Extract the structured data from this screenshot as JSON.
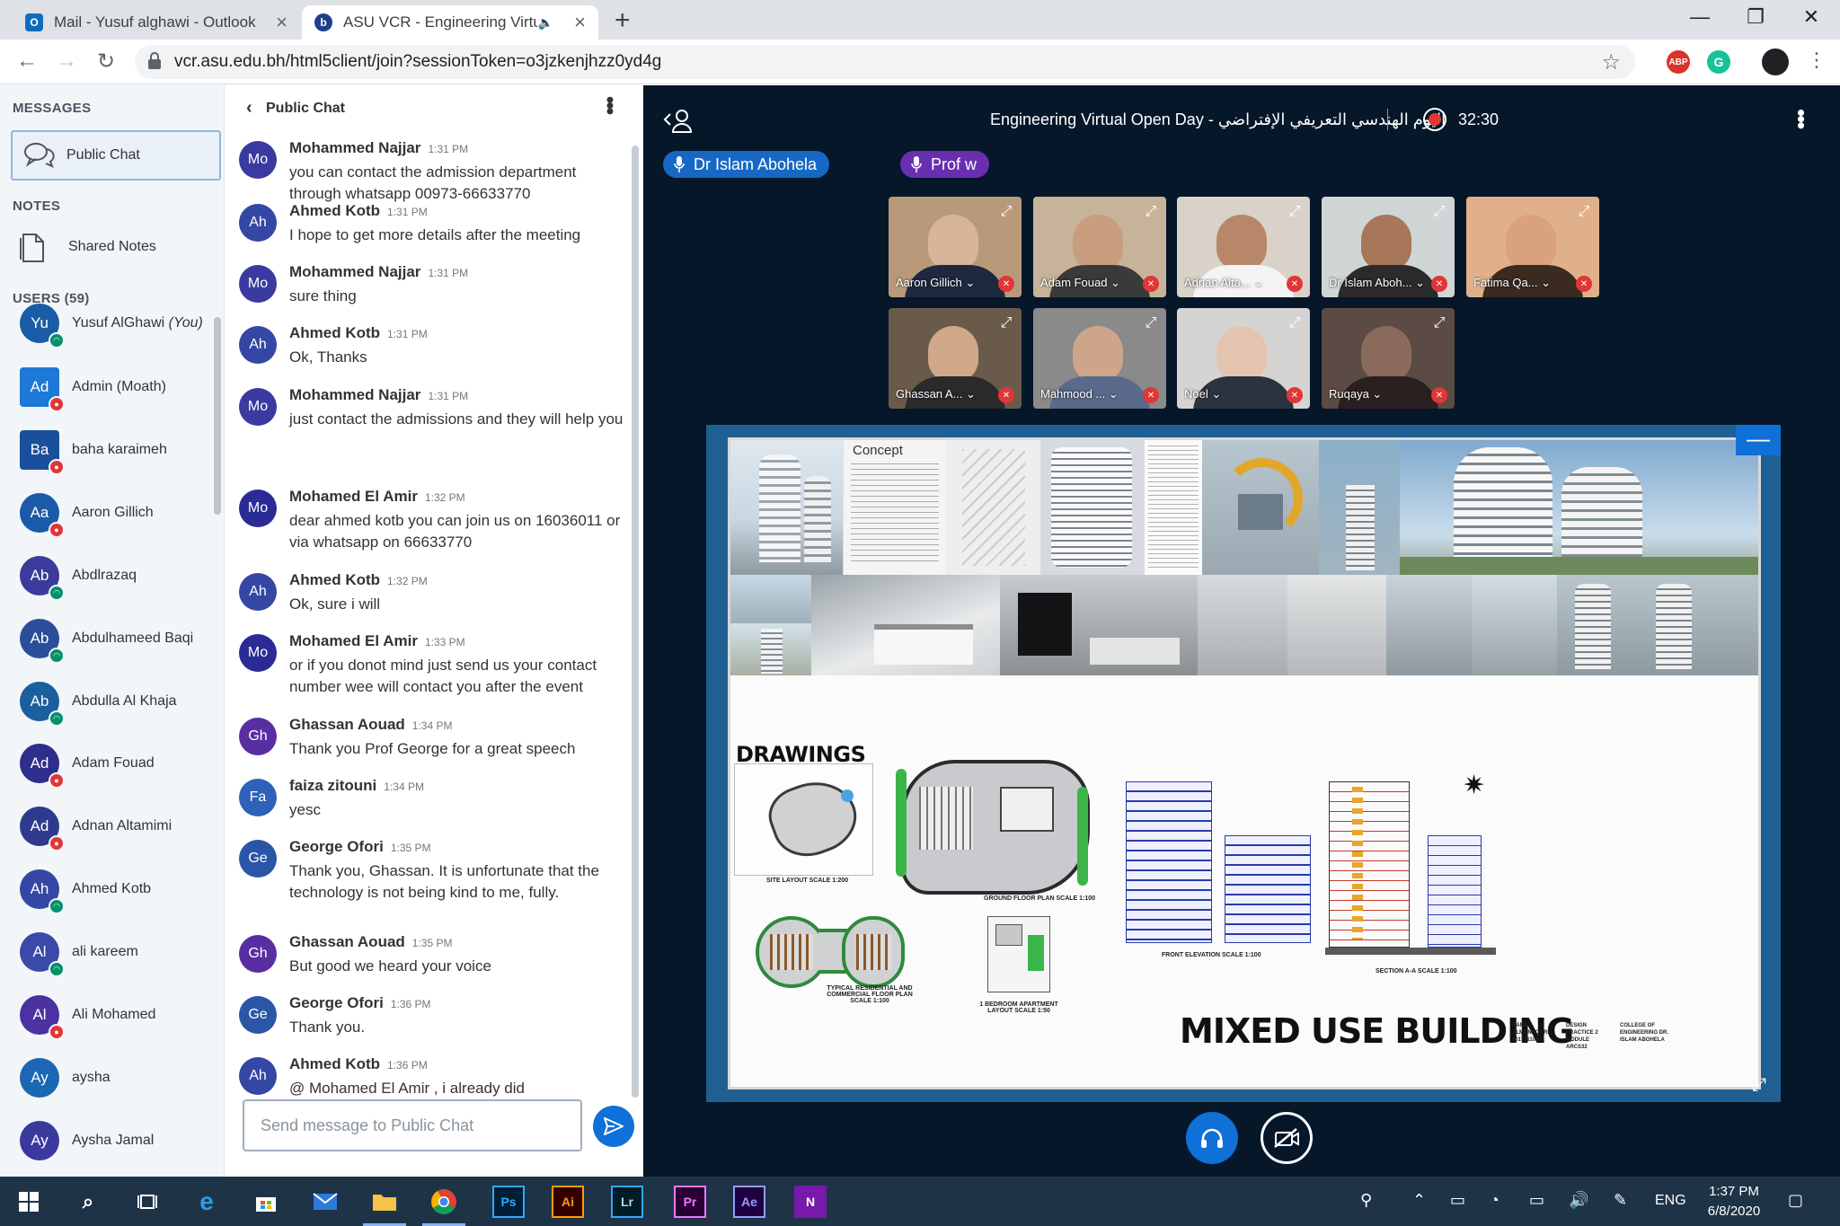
{
  "browser": {
    "tabs": [
      {
        "title": "Mail - Yusuf alghawi - Outlook",
        "icon": "outlook-icon",
        "active": false
      },
      {
        "title": "ASU VCR - Engineering Virtu",
        "icon": "bigbluebutton-icon",
        "active": true
      }
    ],
    "url": "vcr.asu.edu.bh/html5client/join?sessionToken=o3jzkenjhzz0yd4g",
    "extensions": [
      "ABP",
      "G"
    ]
  },
  "sidebar": {
    "messages_title": "MESSAGES",
    "public_chat_label": "Public Chat",
    "notes_title": "NOTES",
    "shared_notes_label": "Shared Notes",
    "users_title": "USERS (59)",
    "users": [
      {
        "initials": "Yu",
        "name": "Yusuf AlGhawi",
        "suffix": "(You)",
        "color": "#1a5ca6",
        "status": "listen"
      },
      {
        "initials": "Ad",
        "name": "Admin (Moath)",
        "suffix": "",
        "color": "#1d78d6",
        "status": "muted",
        "square": true
      },
      {
        "initials": "Ba",
        "name": "baha karaimeh",
        "suffix": "",
        "color": "#1a4f9c",
        "status": "muted",
        "square": true
      },
      {
        "initials": "Aa",
        "name": "Aaron Gillich",
        "suffix": "",
        "color": "#1b5aa8",
        "status": "muted"
      },
      {
        "initials": "Ab",
        "name": "Abdlrazaq",
        "suffix": "",
        "color": "#3b3b9c",
        "status": "listen"
      },
      {
        "initials": "Ab",
        "name": "Abdulhameed Baqi",
        "suffix": "",
        "color": "#2a4e9c",
        "status": "listen"
      },
      {
        "initials": "Ab",
        "name": "Abdulla Al Khaja",
        "suffix": "",
        "color": "#1a5f9e",
        "status": "listen"
      },
      {
        "initials": "Ad",
        "name": "Adam Fouad",
        "suffix": "",
        "color": "#2e2e8c",
        "status": "muted"
      },
      {
        "initials": "Ad",
        "name": "Adnan Altamimi",
        "suffix": "",
        "color": "#2f3a8f",
        "status": "muted"
      },
      {
        "initials": "Ah",
        "name": "Ahmed Kotb",
        "suffix": "",
        "color": "#3547a5",
        "status": "listen"
      },
      {
        "initials": "Al",
        "name": "ali kareem",
        "suffix": "",
        "color": "#3b4aa8",
        "status": "listen"
      },
      {
        "initials": "Al",
        "name": "Ali Mohamed",
        "suffix": "",
        "color": "#4a33a0",
        "status": "muted"
      },
      {
        "initials": "Ay",
        "name": "aysha",
        "suffix": "",
        "color": "#1b67b3",
        "status": ""
      },
      {
        "initials": "Ay",
        "name": "Aysha Jamal",
        "suffix": "",
        "color": "#3a3a9e",
        "status": ""
      }
    ]
  },
  "chat": {
    "title": "Public Chat",
    "input_placeholder": "Send message to Public Chat",
    "messages": [
      {
        "initials": "Mo",
        "sender": "Mohammed Najjar",
        "time": "1:31 PM",
        "text": "you can contact the admission department through whatsapp 00973-66633770",
        "color": "#3a3aa0"
      },
      {
        "initials": "Ah",
        "sender": "Ahmed Kotb",
        "time": "1:31 PM",
        "text": "I hope to get more details after the meeting",
        "color": "#3547a5"
      },
      {
        "initials": "Mo",
        "sender": "Mohammed Najjar",
        "time": "1:31 PM",
        "text": "sure thing",
        "color": "#3a3aa0"
      },
      {
        "initials": "Ah",
        "sender": "Ahmed Kotb",
        "time": "1:31 PM",
        "text": "Ok, Thanks",
        "color": "#3547a5"
      },
      {
        "initials": "Mo",
        "sender": "Mohammed Najjar",
        "time": "1:31 PM",
        "text": "just contact the admissions and they will help you",
        "color": "#3a3aa0"
      },
      {
        "initials": "Mo",
        "sender": "Mohamed El Amir",
        "time": "1:32 PM",
        "text": "dear ahmed kotb you can join us on 16036011 or via whatsapp on 66633770",
        "color": "#2b2b96"
      },
      {
        "initials": "Ah",
        "sender": "Ahmed Kotb",
        "time": "1:32 PM",
        "text": "Ok, sure i will",
        "color": "#3547a5"
      },
      {
        "initials": "Mo",
        "sender": "Mohamed El Amir",
        "time": "1:33 PM",
        "text": "or if you donot mind just send us your contact number wee will contact you after the event",
        "color": "#2b2b96"
      },
      {
        "initials": "Gh",
        "sender": "Ghassan Aouad",
        "time": "1:34 PM",
        "text": "Thank you Prof George for a great speech",
        "color": "#5a2ea3"
      },
      {
        "initials": "Fa",
        "sender": "faiza zitouni",
        "time": "1:34 PM",
        "text": "yesc",
        "color": "#2e61b8"
      },
      {
        "initials": "Ge",
        "sender": "George Ofori",
        "time": "1:35 PM",
        "text": "Thank you, Ghassan. It is unfortunate that the technology is not being kind to me, fully.",
        "color": "#2a56a8"
      },
      {
        "initials": "Gh",
        "sender": "Ghassan Aouad",
        "time": "1:35 PM",
        "text": "But good we heard your voice",
        "color": "#5a2ea3"
      },
      {
        "initials": "Ge",
        "sender": "George Ofori",
        "time": "1:36 PM",
        "text": "Thank you.",
        "color": "#2a56a8"
      },
      {
        "initials": "Ah",
        "sender": "Ahmed Kotb",
        "time": "1:36 PM",
        "text": "@ Mohamed El Amir , i already did",
        "color": "#3547a5"
      }
    ]
  },
  "meeting": {
    "title": "Engineering Virtual Open Day - اليوم الهندسي التعريفي الإفتراضي",
    "record_time": "32:30",
    "talkers": [
      {
        "name": "Dr Islam Abohela",
        "color": "#1768c4"
      },
      {
        "name": "Prof w",
        "color": "#6a2fb0"
      }
    ],
    "videos": [
      {
        "label": "Aaron Gillich",
        "bg": "#b89a7a",
        "skin": "#d7b59a",
        "shirt": "#1e2940"
      },
      {
        "label": "Adam Fouad",
        "bg": "#c7b39a",
        "skin": "#c99e7e",
        "shirt": "#3a3a3a"
      },
      {
        "label": "Adnan Alta...",
        "bg": "#d9d2c8",
        "skin": "#b8876a",
        "shirt": "#f4f4f4"
      },
      {
        "label": "Dr Islam Aboh...",
        "bg": "#cfd6d5",
        "skin": "#a8765a",
        "shirt": "#2b2b2b"
      },
      {
        "label": "Fatima Qa...",
        "bg": "#e0b08a",
        "skin": "#d9a17e",
        "shirt": "#3a2a20"
      },
      {
        "label": "Ghassan A...",
        "bg": "#6a5a4a",
        "skin": "#cfa889",
        "shirt": "#2a2a2a"
      },
      {
        "label": "Mahmood ...",
        "bg": "#8a8a8a",
        "skin": "#cda58a",
        "shirt": "#5a6a8a"
      },
      {
        "label": "Noel",
        "bg": "#d6d4d2",
        "skin": "#e3c4b0",
        "shirt": "#2b3240"
      },
      {
        "label": "Ruqaya",
        "bg": "#5c4a44",
        "skin": "#8a6a5a",
        "shirt": "#2a2020"
      }
    ]
  },
  "slide": {
    "concept_label": "Concept",
    "drawings_label": "DRAWINGS",
    "title": "MIXED USE BUILDING",
    "captions": {
      "site_layout": "SITE LAYOUT SCALE 1:200",
      "ground_floor": "GROUND FLOOR PLAN SCALE 1:100",
      "front_elevation": "FRONT ELEVATION SCALE 1:100",
      "section": "SECTION A-A SCALE 1:100",
      "typical_floor": "TYPICAL RESIDENTIAL AND COMMERCIAL FLOOR PLAN SCALE 1:100",
      "bedroom": "1 BEDROOM APARTMENT LAYOUT SCALE 1:50"
    },
    "info": {
      "student": "RAMA ALMANSOORI 20171110231",
      "course": "DESIGN PRACTICE 2 MODULE ARCS32",
      "college": "COLLEGE OF ENGINEERING DR. ISLAM ABOHELA"
    }
  },
  "taskbar": {
    "apps": [
      "Ps",
      "Ai",
      "Lr",
      "Pr",
      "Ae",
      "N"
    ],
    "language": "ENG",
    "time": "1:37 PM",
    "date": "6/8/2020"
  }
}
